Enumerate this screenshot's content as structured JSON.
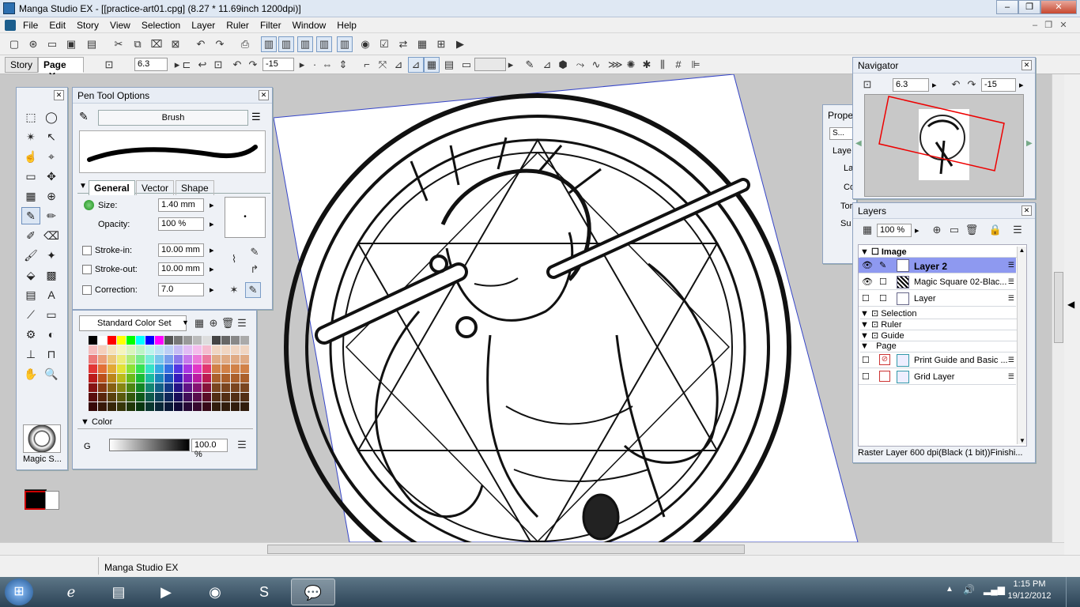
{
  "window": {
    "title": "Manga Studio EX - [[practice-art01.cpg] (8.27 * 11.69inch 1200dpi)]",
    "minimize": "–",
    "restore": "❐",
    "close": "✕"
  },
  "menu": [
    "File",
    "Edit",
    "Story",
    "View",
    "Selection",
    "Layer",
    "Ruler",
    "Filter",
    "Window",
    "Help"
  ],
  "doc_tabs": {
    "story": "Story",
    "page": "Page",
    "close": "✕"
  },
  "toolbar2": {
    "zoom": "6.3",
    "angle": "-15"
  },
  "tool_panel": {
    "footer_label": "Magic S..."
  },
  "pen_options": {
    "title": "Pen Tool Options",
    "brush_label": "Brush",
    "tabs": [
      "General",
      "Vector",
      "Shape"
    ],
    "size_label": "Size:",
    "size_value": "1.40 mm",
    "opacity_label": "Opacity:",
    "opacity_value": "100 %",
    "stroke_in_label": "Stroke-in:",
    "stroke_in_value": "10.00 mm",
    "stroke_out_label": "Stroke-out:",
    "stroke_out_value": "10.00 mm",
    "correction_label": "Correction:",
    "correction_value": "7.0"
  },
  "color_set": {
    "select": "Standard Color Set",
    "color_section": "Color",
    "channel": "G",
    "value": "100.0 %"
  },
  "navigator": {
    "title": "Navigator",
    "zoom": "6.3",
    "angle": "-15"
  },
  "properties": {
    "title": "Prope",
    "tab": "S...",
    "rows": [
      "Laye",
      "La",
      "Co",
      "Tor",
      "Su"
    ]
  },
  "layers": {
    "title": "Layers",
    "zoom": "100 %",
    "image_group": "Image",
    "rows": [
      {
        "name": "Layer 2",
        "selected": true
      },
      {
        "name": "Magic Square 02-Blac...",
        "selected": false
      },
      {
        "name": "Layer",
        "selected": false
      }
    ],
    "groups": [
      "Selection",
      "Ruler",
      "Guide",
      "Page"
    ],
    "page_rows": [
      "Print Guide and Basic ...",
      "Grid Layer"
    ],
    "status": "Raster Layer 600 dpi(Black (1 bit))Finishi..."
  },
  "statusbar": {
    "text": "Manga Studio EX"
  },
  "taskbar": {
    "time": "1:15 PM",
    "date": "19/12/2012"
  },
  "colors": {
    "accent": "#8e99f0",
    "titlebar": "#dfe8f3",
    "panel": "#eef1f6"
  }
}
